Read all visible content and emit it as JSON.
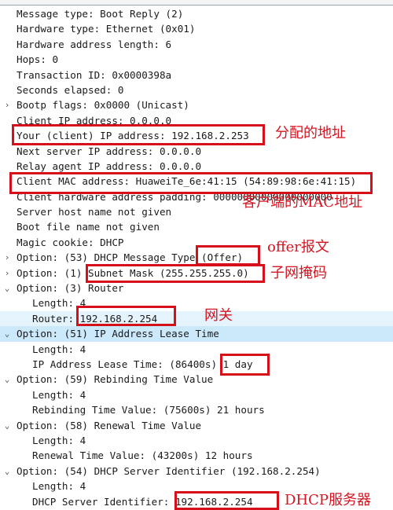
{
  "rows": [
    {
      "text": "Message type: Boot Reply (2)",
      "expander": "none",
      "level": 0
    },
    {
      "text": "Hardware type: Ethernet (0x01)",
      "expander": "none",
      "level": 0
    },
    {
      "text": "Hardware address length: 6",
      "expander": "none",
      "level": 0
    },
    {
      "text": "Hops: 0",
      "expander": "none",
      "level": 0
    },
    {
      "text": "Transaction ID: 0x0000398a",
      "expander": "none",
      "level": 0
    },
    {
      "text": "Seconds elapsed: 0",
      "expander": "none",
      "level": 0
    },
    {
      "text": "Bootp flags: 0x0000 (Unicast)",
      "expander": "collapsed",
      "level": 0
    },
    {
      "text": "Client IP address: 0.0.0.0",
      "expander": "none",
      "level": 0
    },
    {
      "text": "Your (client) IP address: 192.168.2.253",
      "expander": "none",
      "level": 0
    },
    {
      "text": "Next server IP address: 0.0.0.0",
      "expander": "none",
      "level": 0
    },
    {
      "text": "Relay agent IP address: 0.0.0.0",
      "expander": "none",
      "level": 0
    },
    {
      "text": "Client MAC address: HuaweiTe_6e:41:15 (54:89:98:6e:41:15)",
      "expander": "none",
      "level": 0
    },
    {
      "text": "Client hardware address padding: 00000000000000000000",
      "expander": "none",
      "level": 0
    },
    {
      "text": "Server host name not given",
      "expander": "none",
      "level": 0
    },
    {
      "text": "Boot file name not given",
      "expander": "none",
      "level": 0
    },
    {
      "text": "Magic cookie: DHCP",
      "expander": "none",
      "level": 0
    },
    {
      "text": "Option: (53) DHCP Message Type (Offer)",
      "expander": "collapsed",
      "level": 0
    },
    {
      "text": "Option: (1) Subnet Mask (255.255.255.0)",
      "expander": "collapsed",
      "level": 0
    },
    {
      "text": "Option: (3) Router",
      "expander": "expanded",
      "level": 0
    },
    {
      "text": "Length: 4",
      "expander": "none",
      "level": 1
    },
    {
      "text": "Router: 192.168.2.254",
      "expander": "none",
      "level": 1
    },
    {
      "text": "Option: (51) IP Address Lease Time",
      "expander": "expanded",
      "level": 0
    },
    {
      "text": "Length: 4",
      "expander": "none",
      "level": 1
    },
    {
      "text": "IP Address Lease Time: (86400s) 1 day",
      "expander": "none",
      "level": 1
    },
    {
      "text": "Option: (59) Rebinding Time Value",
      "expander": "expanded",
      "level": 0
    },
    {
      "text": "Length: 4",
      "expander": "none",
      "level": 1
    },
    {
      "text": "Rebinding Time Value: (75600s) 21 hours",
      "expander": "none",
      "level": 1
    },
    {
      "text": "Option: (58) Renewal Time Value",
      "expander": "expanded",
      "level": 0
    },
    {
      "text": "Length: 4",
      "expander": "none",
      "level": 1
    },
    {
      "text": "Renewal Time Value: (43200s) 12 hours",
      "expander": "none",
      "level": 1
    },
    {
      "text": "Option: (54) DHCP Server Identifier (192.168.2.254)",
      "expander": "expanded",
      "level": 0
    },
    {
      "text": "Length: 4",
      "expander": "none",
      "level": 1
    },
    {
      "text": "DHCP Server Identifier: 192.168.2.254",
      "expander": "none",
      "level": 1
    }
  ],
  "icons": {
    "collapsed": "›",
    "expanded": "⌄"
  },
  "annotations": {
    "assigned_address": "分配的地址",
    "client_mac": "客户端的MAC地址",
    "offer_message": "offer报文",
    "subnet_mask": "子网掩码",
    "gateway": "网关",
    "dhcp_server": "DHCP服务器"
  },
  "colors": {
    "annotation_red": "#d41420",
    "selected_row": "#cce8fb",
    "hover_row": "#e5f3fd"
  }
}
